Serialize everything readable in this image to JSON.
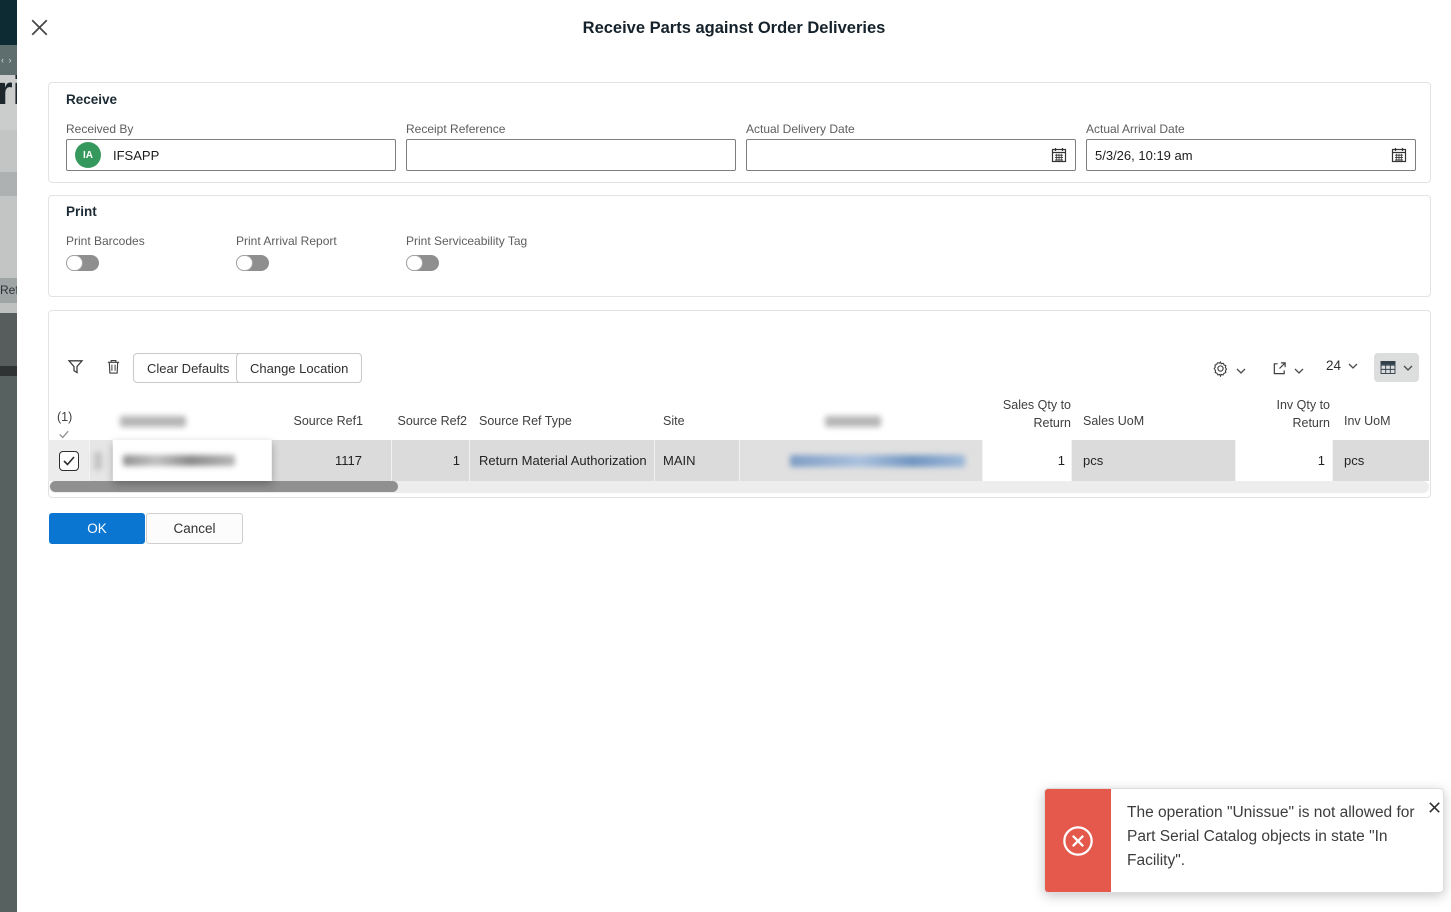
{
  "dialog": {
    "title": "Receive Parts against Order Deliveries"
  },
  "receive": {
    "title": "Receive",
    "received_by": {
      "label": "Received By",
      "value": "IFSAPP",
      "avatar_initials": "IA"
    },
    "receipt_reference": {
      "label": "Receipt Reference",
      "value": ""
    },
    "actual_delivery_date": {
      "label": "Actual Delivery Date",
      "value": ""
    },
    "actual_arrival_date": {
      "label": "Actual Arrival Date",
      "value": "5/3/26, 10:19 am"
    }
  },
  "print": {
    "title": "Print",
    "toggles": [
      {
        "label": "Print Barcodes",
        "state": "off"
      },
      {
        "label": "Print Arrival Report",
        "state": "off"
      },
      {
        "label": "Print Serviceability Tag",
        "state": "off"
      }
    ]
  },
  "table": {
    "toolbar": {
      "clear_defaults": "Clear Defaults",
      "change_location": "Change Location",
      "page_size": "24"
    },
    "selection_count": "(1)",
    "headers": {
      "source_ref1": "Source Ref1",
      "source_ref2": "Source Ref2",
      "source_ref_type": "Source Ref Type",
      "site": "Site",
      "sales_qty_to_return": "Sales Qty to Return",
      "sales_uom": "Sales UoM",
      "inv_qty_to_return": "Inv Qty to Return",
      "inv_uom": "Inv UoM"
    },
    "row": {
      "selected": true,
      "source_ref1": "1117",
      "source_ref2": "1",
      "source_ref_type": "Return Material Authorization",
      "site": "MAIN",
      "sales_qty_to_return": "1",
      "sales_uom": "pcs",
      "inv_qty_to_return": "1",
      "inv_uom": "pcs"
    }
  },
  "actions": {
    "ok": "OK",
    "cancel": "Cancel"
  },
  "toast": {
    "type": "error",
    "message": "The operation \"Unissue\" is not allowed for Part Serial Catalog objects in state \"In Facility\"."
  },
  "background_page": {
    "partial_title": "ri",
    "partial_label": "Ref",
    "breadcrumb_marks": "‹ ›"
  },
  "colors": {
    "primary": "#0b76d2",
    "error": "#e4594b",
    "avatar_green": "#35995e"
  }
}
